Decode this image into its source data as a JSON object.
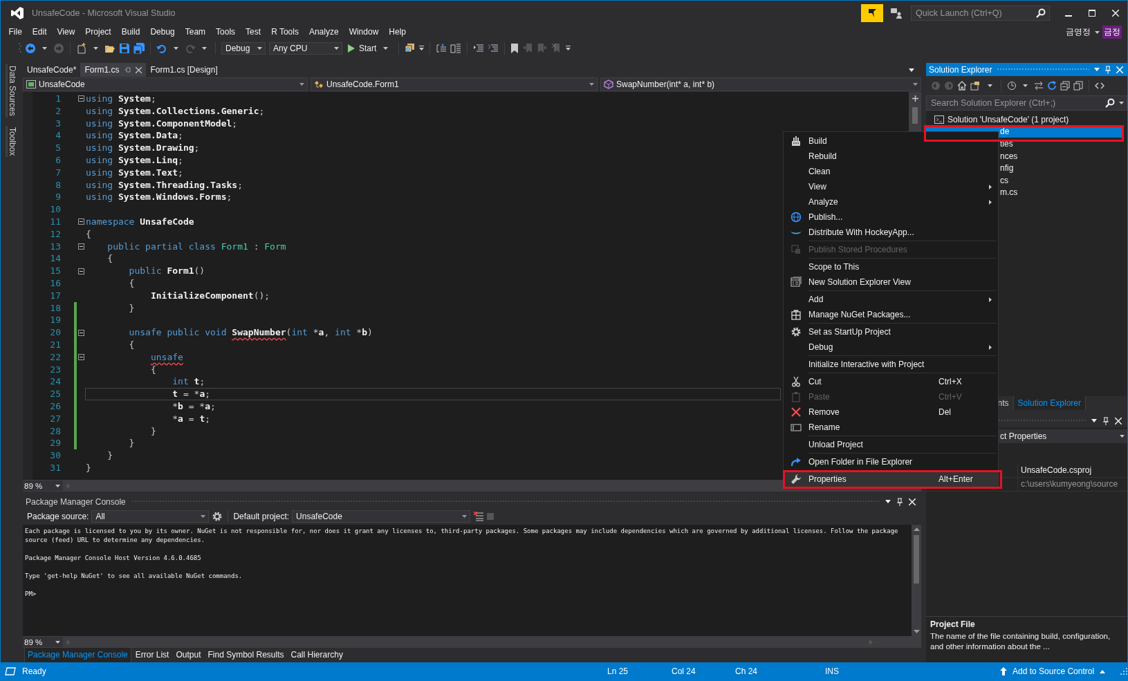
{
  "window": {
    "title": "UnsafeCode - Microsoft Visual Studio"
  },
  "quick_launch": {
    "placeholder": "Quick Launch (Ctrl+Q)"
  },
  "account": {
    "user_name": "금영정",
    "initials": "금정"
  },
  "menu": [
    "File",
    "Edit",
    "View",
    "Project",
    "Build",
    "Debug",
    "Team",
    "Tools",
    "Test",
    "R Tools",
    "Analyze",
    "Window",
    "Help"
  ],
  "toolbar": {
    "configuration": "Debug",
    "platform": "Any CPU",
    "start": "Start"
  },
  "side_tabs": [
    "Data Sources",
    "Toolbox"
  ],
  "document_tabs": [
    {
      "label": "UnsafeCode*",
      "selected": false
    },
    {
      "label": "Form1.cs",
      "selected": true
    },
    {
      "label": "Form1.cs [Design]",
      "selected": false
    }
  ],
  "navigation": {
    "project": "UnsafeCode",
    "type": "UnsafeCode.Form1",
    "member": "SwapNumber(int* a, int* b)"
  },
  "code": {
    "lines": [
      {
        "number": "1",
        "fold": true,
        "changed": false,
        "current": false,
        "tokens": [
          {
            "kind": "kw",
            "text": "using "
          },
          {
            "kind": "id",
            "text": "System"
          },
          {
            "kind": "p",
            "text": ";"
          }
        ]
      },
      {
        "number": "2",
        "fold": false,
        "changed": false,
        "current": false,
        "tokens": [
          {
            "kind": "kw",
            "text": "using "
          },
          {
            "kind": "id",
            "text": "System.Collections.Generic"
          },
          {
            "kind": "p",
            "text": ";"
          }
        ]
      },
      {
        "number": "3",
        "fold": false,
        "changed": false,
        "current": false,
        "tokens": [
          {
            "kind": "kw",
            "text": "using "
          },
          {
            "kind": "id",
            "text": "System.ComponentModel"
          },
          {
            "kind": "p",
            "text": ";"
          }
        ]
      },
      {
        "number": "4",
        "fold": false,
        "changed": false,
        "current": false,
        "tokens": [
          {
            "kind": "kw",
            "text": "using "
          },
          {
            "kind": "id",
            "text": "System.Data"
          },
          {
            "kind": "p",
            "text": ";"
          }
        ]
      },
      {
        "number": "5",
        "fold": false,
        "changed": false,
        "current": false,
        "tokens": [
          {
            "kind": "kw",
            "text": "using "
          },
          {
            "kind": "id",
            "text": "System.Drawing"
          },
          {
            "kind": "p",
            "text": ";"
          }
        ]
      },
      {
        "number": "6",
        "fold": false,
        "changed": false,
        "current": false,
        "tokens": [
          {
            "kind": "kw",
            "text": "using "
          },
          {
            "kind": "id",
            "text": "System.Linq"
          },
          {
            "kind": "p",
            "text": ";"
          }
        ]
      },
      {
        "number": "7",
        "fold": false,
        "changed": false,
        "current": false,
        "tokens": [
          {
            "kind": "kw",
            "text": "using "
          },
          {
            "kind": "id",
            "text": "System.Text"
          },
          {
            "kind": "p",
            "text": ";"
          }
        ]
      },
      {
        "number": "8",
        "fold": false,
        "changed": false,
        "current": false,
        "tokens": [
          {
            "kind": "kw",
            "text": "using "
          },
          {
            "kind": "id",
            "text": "System.Threading.Tasks"
          },
          {
            "kind": "p",
            "text": ";"
          }
        ]
      },
      {
        "number": "9",
        "fold": false,
        "changed": false,
        "current": false,
        "tokens": [
          {
            "kind": "kw",
            "text": "using "
          },
          {
            "kind": "id",
            "text": "System.Windows.Forms"
          },
          {
            "kind": "p",
            "text": ";"
          }
        ]
      },
      {
        "number": "10",
        "fold": false,
        "changed": false,
        "current": false
      },
      {
        "number": "11",
        "fold": true,
        "changed": false,
        "current": false,
        "tokens": [
          {
            "kind": "kw",
            "text": "namespace "
          },
          {
            "kind": "id",
            "text": "UnsafeCode"
          }
        ]
      },
      {
        "number": "12",
        "fold": false,
        "changed": false,
        "current": false,
        "tokens": [
          {
            "kind": "p",
            "text": "{"
          }
        ]
      },
      {
        "number": "13",
        "fold": true,
        "changed": false,
        "current": false,
        "tokens": [
          {
            "kind": "kw",
            "text": "    public partial class "
          },
          {
            "kind": "type",
            "text": "Form1"
          },
          {
            "kind": "p",
            "text": " : "
          },
          {
            "kind": "type",
            "text": "Form"
          }
        ]
      },
      {
        "number": "14",
        "fold": false,
        "changed": false,
        "current": false,
        "tokens": [
          {
            "kind": "p",
            "text": "    {"
          }
        ]
      },
      {
        "number": "15",
        "fold": true,
        "changed": false,
        "current": false,
        "tokens": [
          {
            "kind": "kw",
            "text": "        public "
          },
          {
            "kind": "id",
            "text": "Form1"
          },
          {
            "kind": "p",
            "text": "()"
          }
        ]
      },
      {
        "number": "16",
        "fold": false,
        "changed": false,
        "current": false,
        "tokens": [
          {
            "kind": "p",
            "text": "        {"
          }
        ]
      },
      {
        "number": "17",
        "fold": false,
        "changed": false,
        "current": false,
        "tokens": [
          {
            "kind": "id",
            "text": "            InitializeComponent"
          },
          {
            "kind": "p",
            "text": "();"
          }
        ]
      },
      {
        "number": "18",
        "fold": false,
        "changed": true,
        "current": false,
        "tokens": [
          {
            "kind": "p",
            "text": "        }"
          }
        ]
      },
      {
        "number": "19",
        "fold": false,
        "changed": true,
        "current": false
      },
      {
        "number": "20",
        "fold": true,
        "changed": true,
        "current": false,
        "tokens": [
          {
            "kind": "kw",
            "text": "        unsafe public void "
          },
          {
            "kind": "id",
            "text": "SwapNumber",
            "error": true
          },
          {
            "kind": "p",
            "text": "("
          },
          {
            "kind": "kw",
            "text": "int"
          },
          {
            "kind": "p",
            "text": " *"
          },
          {
            "kind": "id",
            "text": "a"
          },
          {
            "kind": "p",
            "text": ", "
          },
          {
            "kind": "kw",
            "text": "int"
          },
          {
            "kind": "p",
            "text": " *"
          },
          {
            "kind": "id",
            "text": "b"
          },
          {
            "kind": "p",
            "text": ")"
          }
        ]
      },
      {
        "number": "21",
        "fold": false,
        "changed": true,
        "current": false,
        "tokens": [
          {
            "kind": "p",
            "text": "        {"
          }
        ]
      },
      {
        "number": "22",
        "fold": true,
        "changed": true,
        "current": false,
        "tokens": [
          {
            "kind": "kw",
            "text": "            unsafe",
            "error": true
          }
        ]
      },
      {
        "number": "23",
        "fold": false,
        "changed": true,
        "current": false,
        "tokens": [
          {
            "kind": "p",
            "text": "            {"
          }
        ]
      },
      {
        "number": "24",
        "fold": false,
        "changed": true,
        "current": false,
        "tokens": [
          {
            "kind": "kw",
            "text": "                int "
          },
          {
            "kind": "id",
            "text": "t"
          },
          {
            "kind": "p",
            "text": ";"
          }
        ]
      },
      {
        "number": "25",
        "fold": false,
        "changed": true,
        "current": true,
        "tokens": [
          {
            "kind": "id",
            "text": "                t"
          },
          {
            "kind": "p",
            "text": " = *"
          },
          {
            "kind": "id",
            "text": "a"
          },
          {
            "kind": "p",
            "text": ";"
          }
        ]
      },
      {
        "number": "26",
        "fold": false,
        "changed": true,
        "current": false,
        "tokens": [
          {
            "kind": "p",
            "text": "                *"
          },
          {
            "kind": "id",
            "text": "b"
          },
          {
            "kind": "p",
            "text": " = *"
          },
          {
            "kind": "id",
            "text": "a"
          },
          {
            "kind": "p",
            "text": ";"
          }
        ]
      },
      {
        "number": "27",
        "fold": false,
        "changed": true,
        "current": false,
        "tokens": [
          {
            "kind": "p",
            "text": "                *"
          },
          {
            "kind": "id",
            "text": "a"
          },
          {
            "kind": "p",
            "text": " = "
          },
          {
            "kind": "id",
            "text": "t"
          },
          {
            "kind": "p",
            "text": ";"
          }
        ]
      },
      {
        "number": "28",
        "fold": false,
        "changed": true,
        "current": false,
        "tokens": [
          {
            "kind": "p",
            "text": "            }"
          }
        ]
      },
      {
        "number": "29",
        "fold": false,
        "changed": true,
        "current": false,
        "tokens": [
          {
            "kind": "p",
            "text": "        }"
          }
        ]
      },
      {
        "number": "30",
        "fold": false,
        "changed": false,
        "current": false,
        "tokens": [
          {
            "kind": "p",
            "text": "    }"
          }
        ]
      },
      {
        "number": "31",
        "fold": false,
        "changed": false,
        "current": false,
        "tokens": [
          {
            "kind": "p",
            "text": "}"
          }
        ]
      }
    ],
    "zoom": "89 %"
  },
  "console": {
    "title": "Package Manager Console",
    "source_label": "Package source:",
    "source": "All",
    "project_label": "Default project:",
    "project": "UnsafeCode",
    "paragraphs": [
      [
        "Each package is licensed to you by its owner. NuGet is not responsible for, nor does it grant any licenses to, third-party packages. Some packages may include dependencies which are governed by additional licenses. Follow the package",
        "source (feed) URL to determine any dependencies."
      ],
      [
        "Package Manager Console Host Version 4.6.0.4685"
      ],
      [
        "Type 'get-help NuGet' to see all available NuGet commands."
      ],
      [
        "PM>"
      ]
    ],
    "zoom": "89 %"
  },
  "bottom_tabs": [
    {
      "label": "Package Manager Console",
      "selected": true
    },
    {
      "label": "Error List",
      "selected": false
    },
    {
      "label": "Output",
      "selected": false
    },
    {
      "label": "Find Symbol Results",
      "selected": false
    },
    {
      "label": "Call Hierarchy",
      "selected": false
    }
  ],
  "solution_explorer": {
    "title": "Solution Explorer",
    "search_placeholder": "Search Solution Explorer (Ctrl+;)",
    "items": [
      {
        "label": "Solution 'UnsafeCode' (1 project)",
        "selected": false,
        "marked": false,
        "children": [
          {
            "label": "de",
            "selected": true,
            "marked": true,
            "children": [
              {
                "label": "ties",
                "selected": false,
                "marked": false
              },
              {
                "label": "nces",
                "selected": false,
                "marked": false
              },
              {
                "label": "nfig",
                "selected": false,
                "marked": false
              },
              {
                "label": "cs",
                "selected": false,
                "marked": false
              },
              {
                "label": "m.cs",
                "selected": false,
                "marked": false
              }
            ]
          }
        ]
      }
    ]
  },
  "panel_tabs": [
    {
      "label": "nts",
      "selected": false
    },
    {
      "label": "Solution Explorer",
      "selected": true
    }
  ],
  "properties": {
    "object": "ct Properties",
    "rows": [
      "UnsafeCode.csproj",
      "c:\\users\\kumyeong\\source"
    ],
    "description_title": "Project File",
    "description": "The name of the file containing build, configuration, and other information about the ..."
  },
  "context_menu": {
    "items": [
      {
        "kind": "item",
        "label": "Build",
        "submenu": false,
        "disabled": false,
        "selected": false,
        "marked": false
      },
      {
        "kind": "item",
        "label": "Rebuild",
        "submenu": false,
        "disabled": false,
        "selected": false,
        "marked": false
      },
      {
        "kind": "item",
        "label": "Clean",
        "submenu": false,
        "disabled": false,
        "selected": false,
        "marked": false
      },
      {
        "kind": "item",
        "label": "View",
        "submenu": true,
        "disabled": false,
        "selected": false,
        "marked": false
      },
      {
        "kind": "item",
        "label": "Analyze",
        "submenu": true,
        "disabled": false,
        "selected": false,
        "marked": false
      },
      {
        "kind": "item",
        "label": "Publish...",
        "submenu": false,
        "disabled": false,
        "selected": false,
        "marked": false
      },
      {
        "kind": "item",
        "label": "Distribute With HockeyApp...",
        "submenu": false,
        "disabled": false,
        "selected": false,
        "marked": false
      },
      {
        "kind": "separator"
      },
      {
        "kind": "item",
        "label": "Publish Stored Procedures",
        "submenu": false,
        "disabled": true,
        "selected": false,
        "marked": false
      },
      {
        "kind": "separator"
      },
      {
        "kind": "item",
        "label": "Scope to This",
        "submenu": false,
        "disabled": false,
        "selected": false,
        "marked": false
      },
      {
        "kind": "item",
        "label": "New Solution Explorer View",
        "submenu": false,
        "disabled": false,
        "selected": false,
        "marked": false
      },
      {
        "kind": "separator"
      },
      {
        "kind": "item",
        "label": "Add",
        "submenu": true,
        "disabled": false,
        "selected": false,
        "marked": false
      },
      {
        "kind": "item",
        "label": "Manage NuGet Packages...",
        "submenu": false,
        "disabled": false,
        "selected": false,
        "marked": false
      },
      {
        "kind": "separator"
      },
      {
        "kind": "item",
        "label": "Set as StartUp Project",
        "submenu": false,
        "disabled": false,
        "selected": false,
        "marked": false
      },
      {
        "kind": "item",
        "label": "Debug",
        "submenu": true,
        "disabled": false,
        "selected": false,
        "marked": false
      },
      {
        "kind": "separator"
      },
      {
        "kind": "item",
        "label": "Initialize Interactive with Project",
        "submenu": false,
        "disabled": false,
        "selected": false,
        "marked": false
      },
      {
        "kind": "separator"
      },
      {
        "kind": "item",
        "label": "Cut",
        "shortcut": "Ctrl+X",
        "submenu": false,
        "disabled": false,
        "selected": false,
        "marked": false
      },
      {
        "kind": "item",
        "label": "Paste",
        "shortcut": "Ctrl+V",
        "submenu": false,
        "disabled": true,
        "selected": false,
        "marked": false
      },
      {
        "kind": "item",
        "label": "Remove",
        "shortcut": "Del",
        "submenu": false,
        "disabled": false,
        "selected": false,
        "marked": false
      },
      {
        "kind": "item",
        "label": "Rename",
        "submenu": false,
        "disabled": false,
        "selected": false,
        "marked": false
      },
      {
        "kind": "separator"
      },
      {
        "kind": "item",
        "label": "Unload Project",
        "submenu": false,
        "disabled": false,
        "selected": false,
        "marked": false
      },
      {
        "kind": "separator"
      },
      {
        "kind": "item",
        "label": "Open Folder in File Explorer",
        "submenu": false,
        "disabled": false,
        "selected": false,
        "marked": false
      },
      {
        "kind": "separator"
      },
      {
        "kind": "item",
        "label": "Properties",
        "shortcut": "Alt+Enter",
        "submenu": false,
        "disabled": false,
        "selected": true,
        "marked": true
      }
    ]
  },
  "status_bar": {
    "state": "Ready",
    "line": "Ln 25",
    "column": "Col 24",
    "char": "Ch 24",
    "mode": "INS",
    "source_control": "Add to Source Control"
  }
}
